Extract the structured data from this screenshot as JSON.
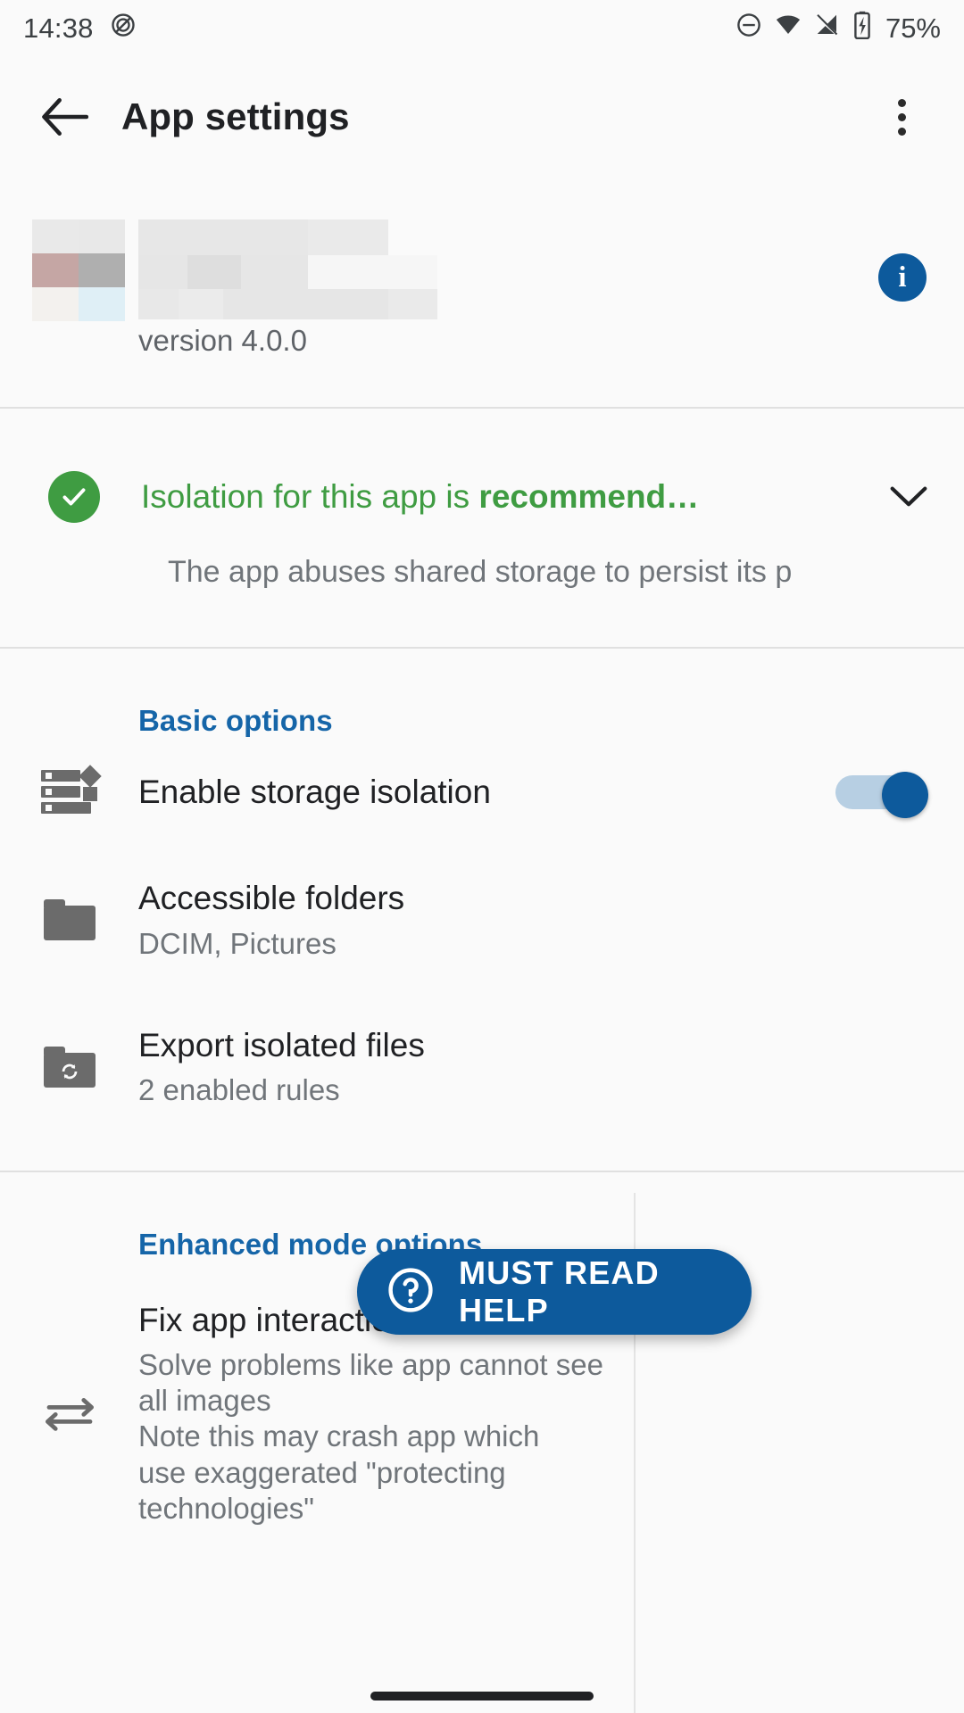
{
  "status_bar": {
    "time": "14:38",
    "battery_percent": "75%",
    "icons": [
      "screenshot-icon",
      "do-not-disturb-icon",
      "wifi-icon",
      "cellular-off-icon",
      "battery-charging-icon"
    ]
  },
  "app_bar": {
    "back_label": "back-arrow",
    "title": "App settings",
    "overflow_label": "more-options"
  },
  "app_header": {
    "app_name_redacted": "",
    "version": "version 4.0.0",
    "info_badge": "i",
    "icon_colors": [
      "#e9e9e9",
      "#e8e8e8",
      "#c5a6a4",
      "#afafaf",
      "#f3f1ee",
      "#dfeff6"
    ],
    "name_blur_colors": [
      "#e7e7e7",
      "#e2e2e2",
      "#e4e4e4",
      "#e9e9e9",
      "#ececec",
      "#e3e3e3",
      "#e1e1e1",
      "#e8e8e8",
      "#f7f7f7",
      "#f6f6f6",
      "#e9e9e9",
      "#ebebeb",
      "#e8e8e8",
      "#e8e8e8",
      "#e9e9e9"
    ]
  },
  "isolation_status": {
    "title_normal": "Isolation for this app is ",
    "title_bold": "recommend…",
    "subtitle": "The app abuses shared storage to persist its pr…",
    "color": "#3f9c42",
    "check_icon": "check-circle-icon",
    "expand_icon": "chevron-down-icon"
  },
  "sections": [
    {
      "header": "Basic options",
      "rows": [
        {
          "icon": "storage-isolation-icon",
          "title": "Enable storage isolation",
          "subtitle": "",
          "control": "switch",
          "switch_on": true
        },
        {
          "icon": "folder-icon",
          "title": "Accessible folders",
          "subtitle": "DCIM, Pictures",
          "control": "none"
        },
        {
          "icon": "folder-sync-icon",
          "title": "Export isolated files",
          "subtitle": "2 enabled rules",
          "control": "none"
        }
      ]
    },
    {
      "header": "Enhanced mode options",
      "rows": [
        {
          "icon": "swap-arrows-icon",
          "title": "Fix app interaction issues",
          "subtitle": "Solve problems like app cannot see\nall images\nNote this may crash app which\nuse exaggerated \"protecting\ntechnologies\"",
          "control": "none"
        }
      ]
    }
  ],
  "fab": {
    "label": "MUST READ HELP",
    "icon": "help-circle-icon",
    "color": "#0d5a9c"
  },
  "colors": {
    "accent_blue": "#0d5a9c",
    "section_header_blue": "#1565a8",
    "ok_green": "#3f9c42",
    "background": "#fafafa",
    "primary_text": "#202124",
    "secondary_text": "#70757a",
    "divider": "#e0e0e0"
  },
  "nav": {
    "gesture_pill": "home-gesture-pill"
  }
}
